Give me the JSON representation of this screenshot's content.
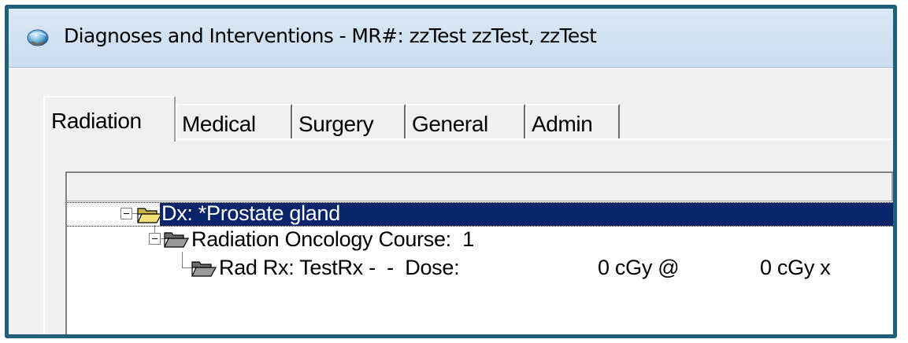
{
  "window": {
    "title": "Diagnoses and Interventions - MR#: zzTest   zzTest, zzTest",
    "icon": "app-globe-icon"
  },
  "tabs": [
    {
      "label": "Radiation",
      "active": true
    },
    {
      "label": "Medical",
      "active": false
    },
    {
      "label": "Surgery",
      "active": false
    },
    {
      "label": "General",
      "active": false
    },
    {
      "label": "Admin",
      "active": false
    }
  ],
  "tree": {
    "nodes": [
      {
        "label": "Dx: *Prostate gland",
        "selected": true,
        "expanded": true,
        "icon": "open-folder-yellow-icon"
      },
      {
        "label": "Radiation Oncology Course:  1",
        "selected": false,
        "expanded": true,
        "icon": "open-folder-gray-icon"
      },
      {
        "label": "Rad Rx: TestRx -  -  Dose:",
        "selected": false,
        "expanded": false,
        "icon": "open-folder-gray-icon",
        "dose_total": "0 cGy @",
        "dose_fraction": "0 cGy x"
      }
    ]
  },
  "colors": {
    "frame_border": "#1f5f7a",
    "selection_bg": "#0a246a",
    "titlebar": "#cadcee"
  }
}
